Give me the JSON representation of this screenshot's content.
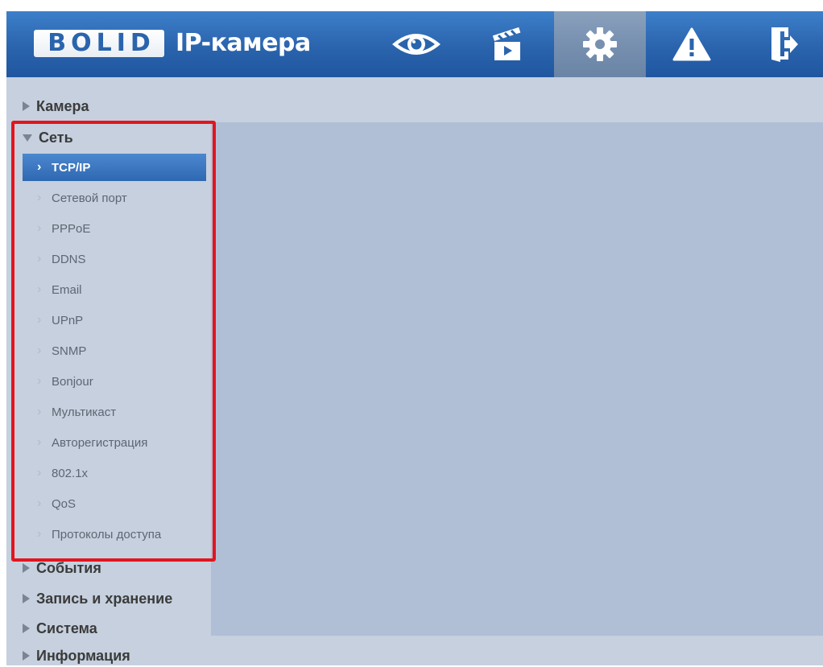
{
  "header": {
    "logo_text": "BOLID",
    "title": "IP-камера",
    "nav_icons": [
      {
        "name": "live-view",
        "icon": "eye-icon",
        "active": false
      },
      {
        "name": "playback",
        "icon": "clapperboard-icon",
        "active": false
      },
      {
        "name": "settings",
        "icon": "gear-icon",
        "active": true
      },
      {
        "name": "alarm",
        "icon": "warning-icon",
        "active": false
      },
      {
        "name": "logout",
        "icon": "exit-door-icon",
        "active": false
      }
    ]
  },
  "sidebar": {
    "camera": "Камера",
    "network": "Сеть",
    "network_items": [
      "TCP/IP",
      "Сетевой порт",
      "PPPoE",
      "DDNS",
      "Email",
      "UPnP",
      "SNMP",
      "Bonjour",
      "Мультикаст",
      "Авторегистрация",
      "802.1x",
      "QoS",
      "Протоколы доступа"
    ],
    "selected_item": "TCP/IP",
    "events": "События",
    "recording": "Запись и хранение",
    "system": "Система",
    "info": "Информация"
  },
  "colors": {
    "header": "#2a64ad",
    "active_item": "#3a74be",
    "sidebar_bg": "#c6d0de",
    "content_bg": "#b0bfd6",
    "highlight": "#e4141d"
  }
}
